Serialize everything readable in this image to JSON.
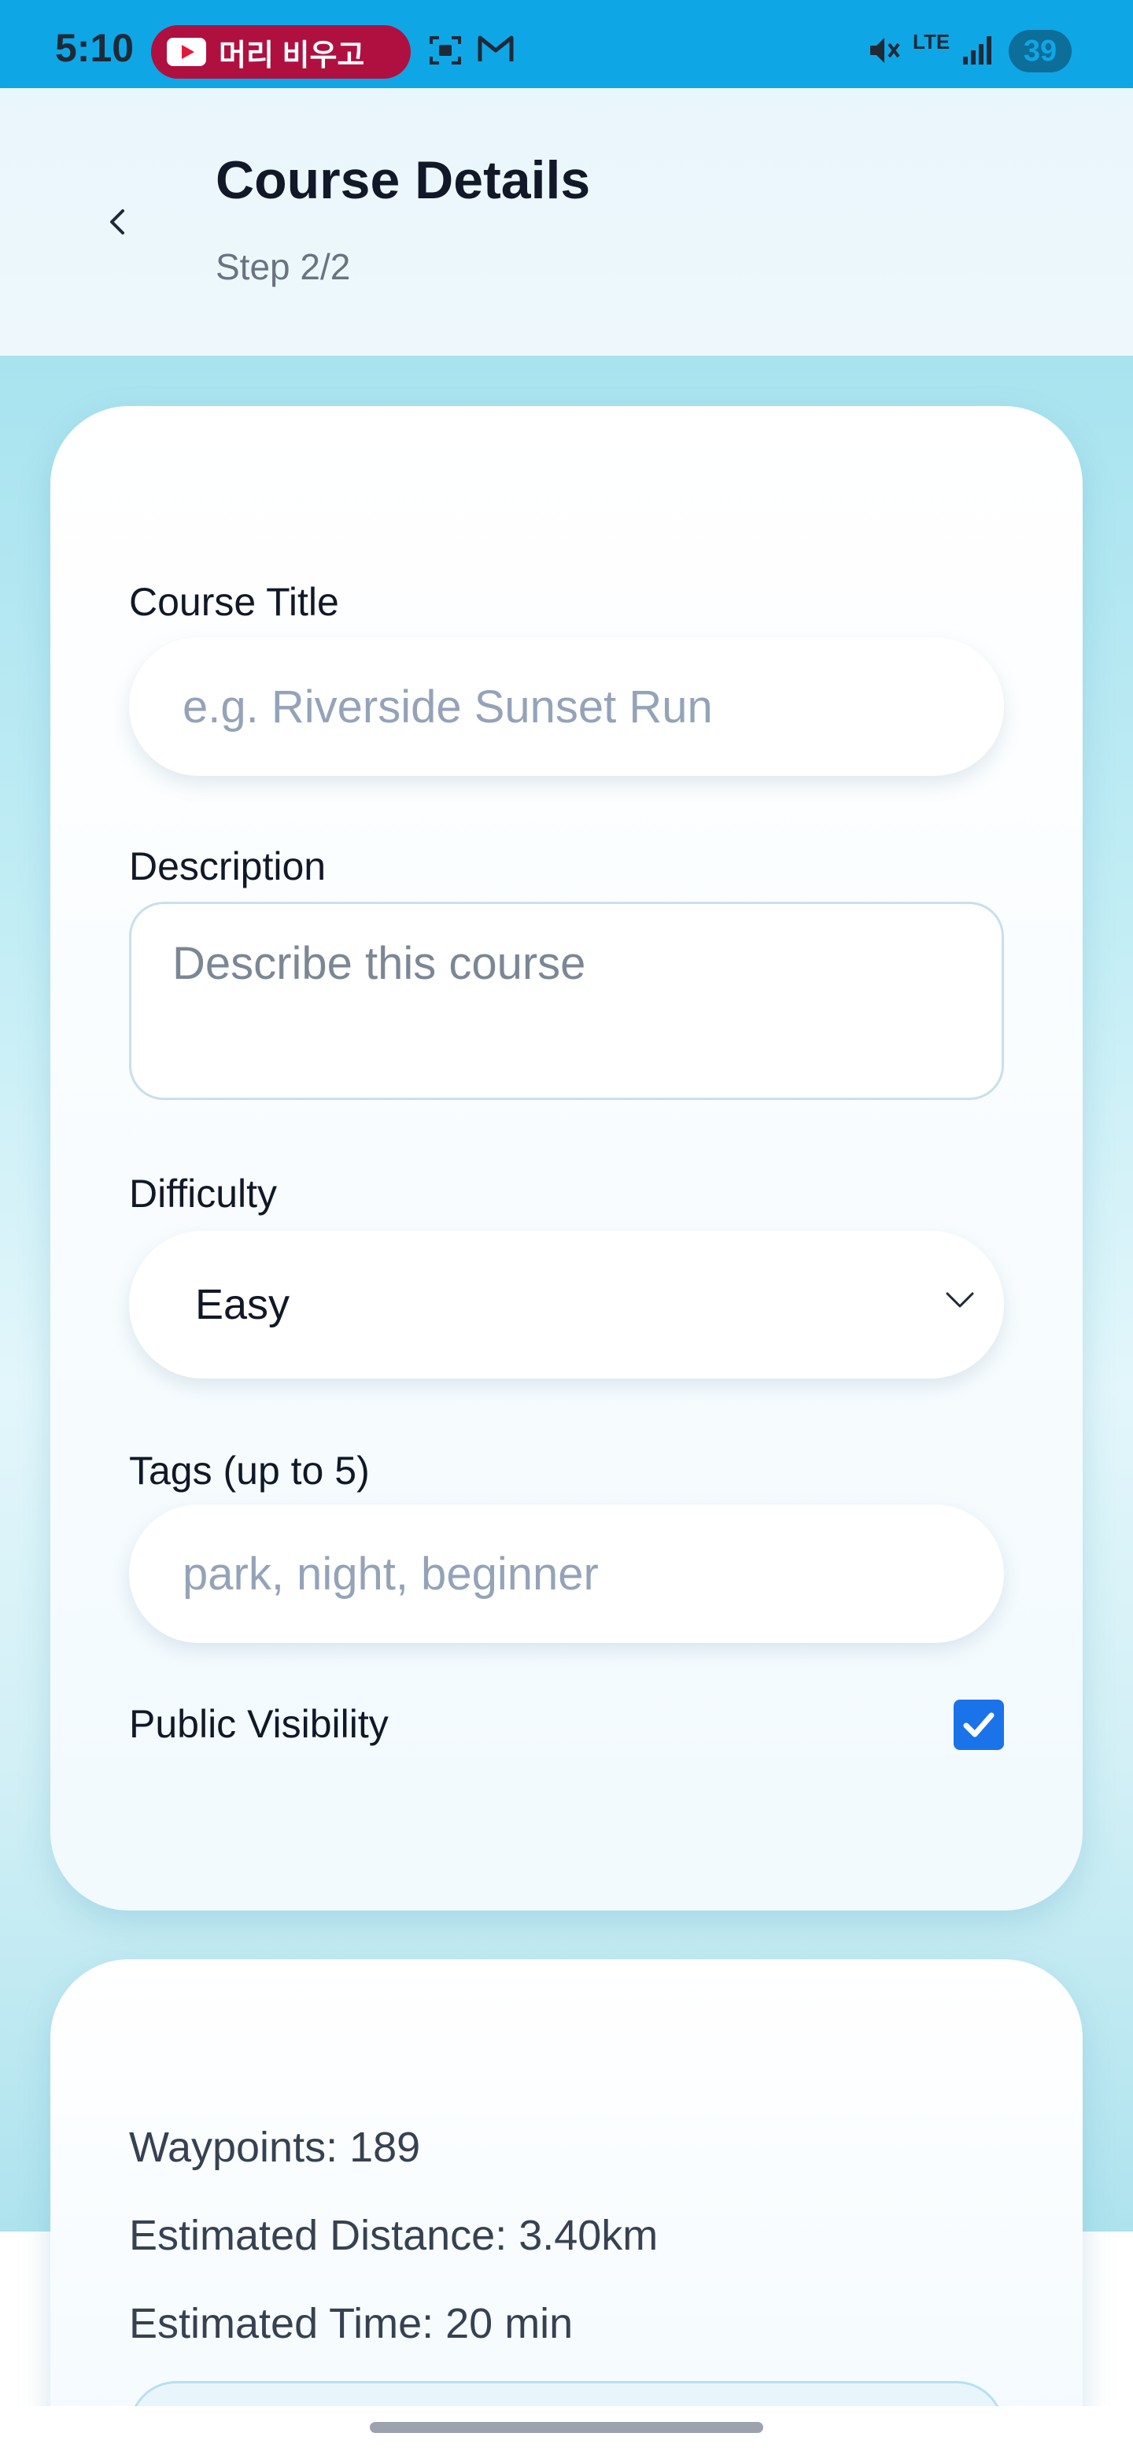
{
  "status_bar": {
    "time": "5:10",
    "media_title": "머리 비우고",
    "battery": "39",
    "network": "LTE"
  },
  "header": {
    "title": "Course Details",
    "subtitle": "Step 2/2"
  },
  "form": {
    "course_title_label": "Course Title",
    "course_title_placeholder": "e.g. Riverside Sunset Run",
    "description_label": "Description",
    "description_placeholder": "Describe this course",
    "difficulty_label": "Difficulty",
    "difficulty_value": "Easy",
    "tags_label": "Tags (up to 5)",
    "tags_placeholder": "park, night, beginner",
    "visibility_label": "Public Visibility",
    "visibility_checked": true
  },
  "stats": {
    "waypoints": "Waypoints: 189",
    "distance": "Estimated Distance: 3.40km",
    "time": "Estimated Time: 20 min"
  },
  "colors": {
    "status_bar": "#0fa6e6",
    "accent": "#1a73e8",
    "background_top": "#a8e3ef"
  }
}
